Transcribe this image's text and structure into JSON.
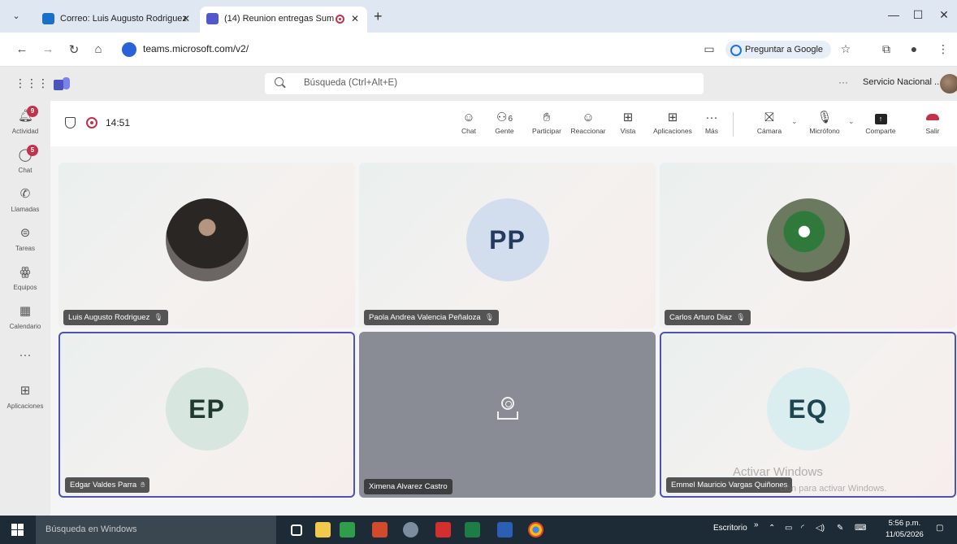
{
  "browser": {
    "tabs": [
      {
        "title": "Correo: Luis Augusto Rodriguez",
        "active": false
      },
      {
        "title": "(14) Reunion entregas Sum",
        "active": true
      }
    ],
    "url": "teams.microsoft.com/v2/",
    "ask_google_label": "Preguntar a Google"
  },
  "teams_header": {
    "search_placeholder": "Búsqueda (Ctrl+Alt+E)",
    "more": "···",
    "org_name": "Servicio Nacional ..."
  },
  "rail": [
    {
      "label": "Actividad",
      "icon": "bell-icon",
      "badge": "9"
    },
    {
      "label": "Chat",
      "icon": "chat-icon",
      "badge": "5"
    },
    {
      "label": "Llamadas",
      "icon": "phone-icon",
      "badge": ""
    },
    {
      "label": "Tareas",
      "icon": "tasks-icon",
      "badge": ""
    },
    {
      "label": "Equipos",
      "icon": "teams-icon",
      "badge": ""
    },
    {
      "label": "Calendario",
      "icon": "calendar-icon",
      "badge": ""
    },
    {
      "label": "",
      "icon": "more-icon",
      "badge": ""
    },
    {
      "label": "Aplicaciones",
      "icon": "apps-icon",
      "badge": ""
    }
  ],
  "meeting": {
    "timer": "14:51",
    "controls": {
      "chat": "Chat",
      "people": "Gente",
      "people_count": "6",
      "raise": "Participar",
      "react": "Reaccionar",
      "view": "Vista",
      "apps": "Aplicaciones",
      "more": "Más",
      "camera": "Cámara",
      "mic": "Micrófono",
      "share": "Comparte",
      "leave": "Salir"
    },
    "participants": [
      {
        "name": "Luis Augusto Rodriguez",
        "initials": "",
        "muted": true
      },
      {
        "name": "Paola Andrea Valencia Peñaloza",
        "initials": "PP",
        "muted": true
      },
      {
        "name": "Carlos Arturo Diaz",
        "initials": "",
        "muted": true
      },
      {
        "name": "Edgar Valdes Parra",
        "initials": "EP",
        "muted": false,
        "speaking": true
      },
      {
        "name": "Ximena Alvarez Castro",
        "initials": "",
        "muted": false
      },
      {
        "name": "Emmel Mauricio Vargas Quiñones",
        "initials": "EQ",
        "muted": false,
        "speaking": true
      }
    ]
  },
  "watermark": {
    "line1": "Activar Windows",
    "line2": "ción para activar Windows."
  },
  "taskbar": {
    "search_text": "Búsqueda en Windows",
    "desktop_label": "Escritorio",
    "time": "5:56 p.m.",
    "date": "11/05/2026"
  },
  "colors": {
    "accent": "#4f52b2",
    "leave": "#c4314b",
    "badge": "#c4314b"
  }
}
